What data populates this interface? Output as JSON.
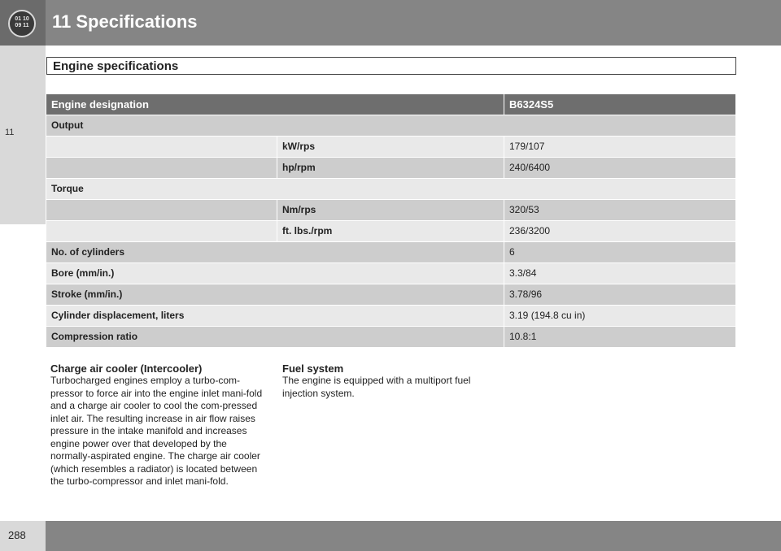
{
  "header": {
    "chapter_title": "11 Specifications",
    "logo_text_line1": "01 10",
    "logo_text_line2": "09 11"
  },
  "side_tab": {
    "label": "11"
  },
  "section": {
    "title": "Engine specifications"
  },
  "table": {
    "header": {
      "label": "Engine designation",
      "value": "B6324S5"
    },
    "output_label": "Output",
    "kw_unit": "kW/rps",
    "kw_value": "179/107",
    "hp_unit": "hp/rpm",
    "hp_value": "240/6400",
    "torque_label": "Torque",
    "nm_unit": "Nm/rps",
    "nm_value": "320/53",
    "ftlbs_unit": "ft. lbs./rpm",
    "ftlbs_value": "236/3200",
    "cylinders_label": "No. of cylinders",
    "cylinders_value": "6",
    "bore_label": "Bore (mm/in.)",
    "bore_value": "3.3/84",
    "stroke_label": "Stroke (mm/in.)",
    "stroke_value": "3.78/96",
    "displacement_label": "Cylinder displacement, liters",
    "displacement_value": "3.19 (194.8 cu in)",
    "compression_label": "Compression ratio",
    "compression_value": "10.8:1"
  },
  "intercooler": {
    "heading": "Charge air cooler (Intercooler)",
    "body": "Turbocharged engines employ a turbo-com-pressor to force air into the engine inlet mani-fold and a charge air cooler to cool the com-pressed inlet air. The resulting increase in air flow raises pressure in the intake manifold and increases engine power over that developed by the normally-aspirated engine. The charge air cooler (which resembles a radiator) is located between the turbo-compressor and inlet mani-fold."
  },
  "fuel_system": {
    "heading": "Fuel system",
    "body": "The engine is equipped with a multiport fuel injection system."
  },
  "footer": {
    "page_number": "288"
  }
}
